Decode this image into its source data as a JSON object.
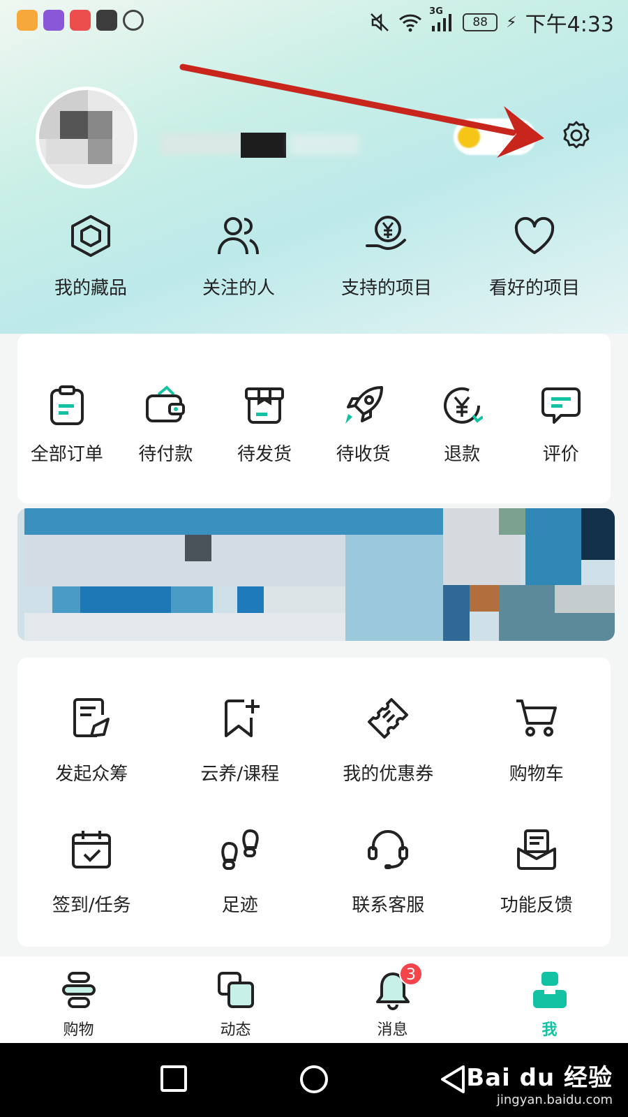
{
  "status_bar": {
    "time": "下午4:33",
    "battery": "88",
    "network": "3G",
    "app_icons": [
      "orange-app-icon",
      "purple-app-icon",
      "red-app-icon",
      "huawei-app-icon",
      "shield-app-icon"
    ],
    "app_icon_colors": [
      "#f7a83a",
      "#8a57d8",
      "#ec4d4d",
      "#3c3c3c",
      "#444444"
    ]
  },
  "profile": {
    "settings_icon": "gear-icon"
  },
  "quick_links": [
    {
      "label": "我的藏品",
      "icon": "cube-icon"
    },
    {
      "label": "关注的人",
      "icon": "users-icon"
    },
    {
      "label": "支持的项目",
      "icon": "yen-hand-icon"
    },
    {
      "label": "看好的项目",
      "icon": "heart-icon"
    }
  ],
  "orders": [
    {
      "label": "全部订单",
      "icon": "clipboard-icon"
    },
    {
      "label": "待付款",
      "icon": "wallet-icon"
    },
    {
      "label": "待发货",
      "icon": "box-icon"
    },
    {
      "label": "待收货",
      "icon": "rocket-icon"
    },
    {
      "label": "退款",
      "icon": "yen-refund-icon"
    },
    {
      "label": "评价",
      "icon": "comment-icon"
    }
  ],
  "tools": [
    {
      "label": "发起众筹",
      "icon": "edit-doc-icon"
    },
    {
      "label": "云养/课程",
      "icon": "bookmark-plus-icon"
    },
    {
      "label": "我的优惠券",
      "icon": "ticket-icon"
    },
    {
      "label": "购物车",
      "icon": "cart-icon"
    },
    {
      "label": "签到/任务",
      "icon": "calendar-check-icon"
    },
    {
      "label": "足迹",
      "icon": "footprints-icon"
    },
    {
      "label": "联系客服",
      "icon": "headset-icon"
    },
    {
      "label": "功能反馈",
      "icon": "mail-icon"
    }
  ],
  "tabs": [
    {
      "label": "购物",
      "icon": "shop-icon"
    },
    {
      "label": "动态",
      "icon": "layers-icon"
    },
    {
      "label": "消息",
      "icon": "bell-icon",
      "badge": "3"
    },
    {
      "label": "我",
      "icon": "person-icon",
      "active": true
    }
  ],
  "watermark": {
    "main": "Bai du 经验",
    "sub": "jingyan.baidu.com"
  },
  "colors": {
    "accent": "#13c2a3",
    "badge": "#f5444a",
    "annotation_arrow": "#c8261d"
  }
}
